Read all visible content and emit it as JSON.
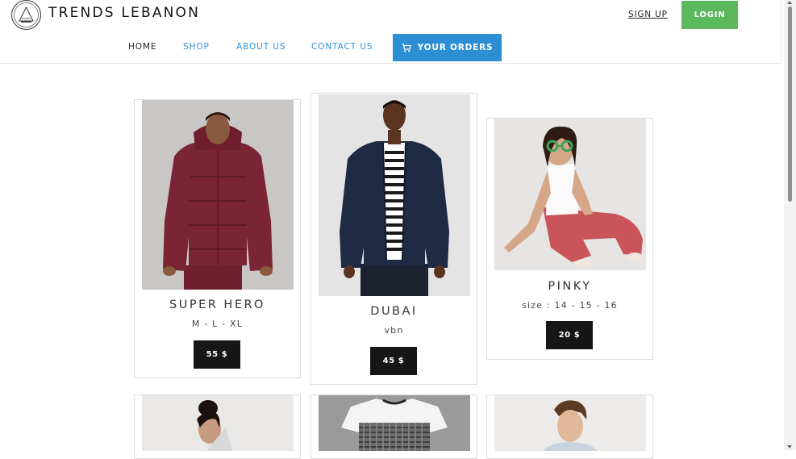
{
  "header": {
    "brand": "TRENDS LEBANON",
    "signup_label": "SIGN UP",
    "login_label": "LOGIN",
    "login_color": "#5cb85c"
  },
  "nav": {
    "items": [
      {
        "label": "HOME",
        "active": true
      },
      {
        "label": "SHOP"
      },
      {
        "label": "ABOUT US"
      },
      {
        "label": "CONTACT US"
      }
    ],
    "orders_label": "YOUR ORDERS",
    "orders_icon": "cart-icon",
    "link_color": "#2f8fd6"
  },
  "products": [
    {
      "name": "SUPER HERO",
      "sizes": "M - L - XL",
      "price": "55 $"
    },
    {
      "name": "DUBAI",
      "sizes": "vbn",
      "price": "45 $"
    },
    {
      "name": "PINKY",
      "sizes": "size : 14 - 15 - 16",
      "price": "20 $"
    }
  ]
}
